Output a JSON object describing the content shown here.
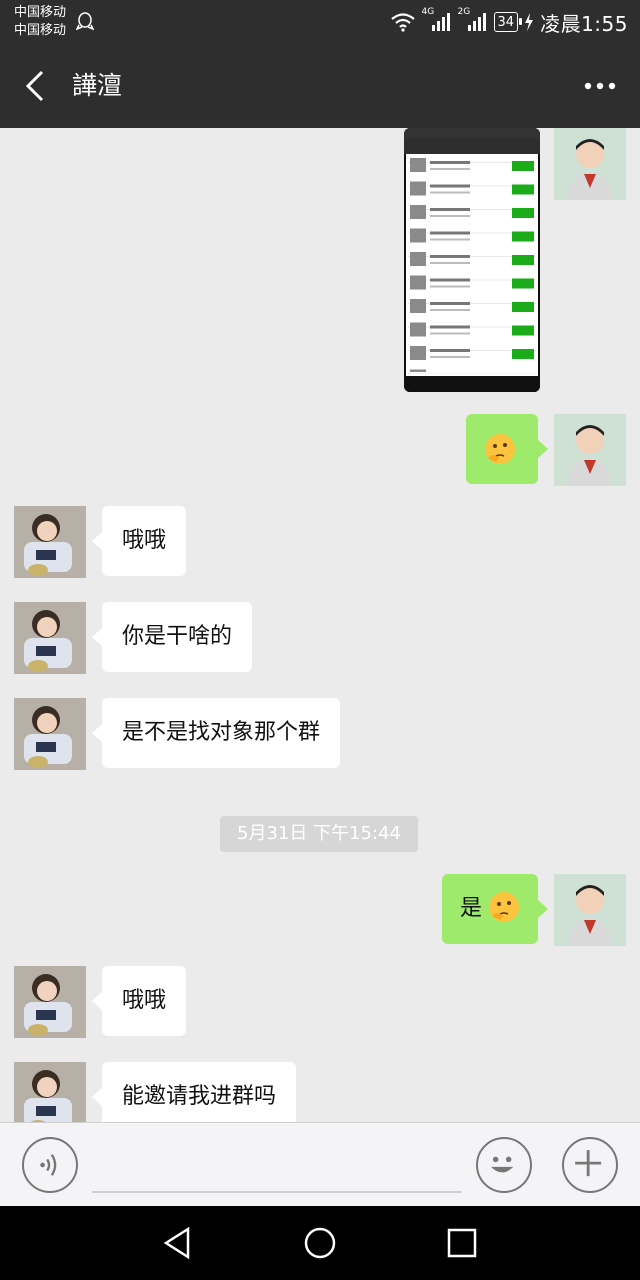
{
  "status_bar": {
    "carrier_1": "中国移动",
    "carrier_2": "中国移动",
    "network_1": "4G",
    "network_2": "2G",
    "battery": "34",
    "time": "凌晨1:55"
  },
  "header": {
    "title": "譁澶"
  },
  "messages": [
    {
      "side": "out",
      "type": "image"
    },
    {
      "side": "out",
      "type": "emoji",
      "emoji": "thinking-face"
    },
    {
      "side": "in",
      "text": "哦哦"
    },
    {
      "side": "in",
      "text": "你是干啥的"
    },
    {
      "side": "in",
      "text": "是不是找对象那个群"
    },
    {
      "side": "out",
      "text": "是",
      "emoji": "thinking-face"
    },
    {
      "side": "in",
      "text": "哦哦"
    },
    {
      "side": "in",
      "text": "能邀请我进群吗"
    }
  ],
  "timestamp": "5月31日 下午15:44",
  "colors": {
    "bar": "#2e2e2e",
    "chat_bg": "#ebebeb",
    "out_bubble": "#9eea6a",
    "in_bubble": "#ffffff"
  }
}
